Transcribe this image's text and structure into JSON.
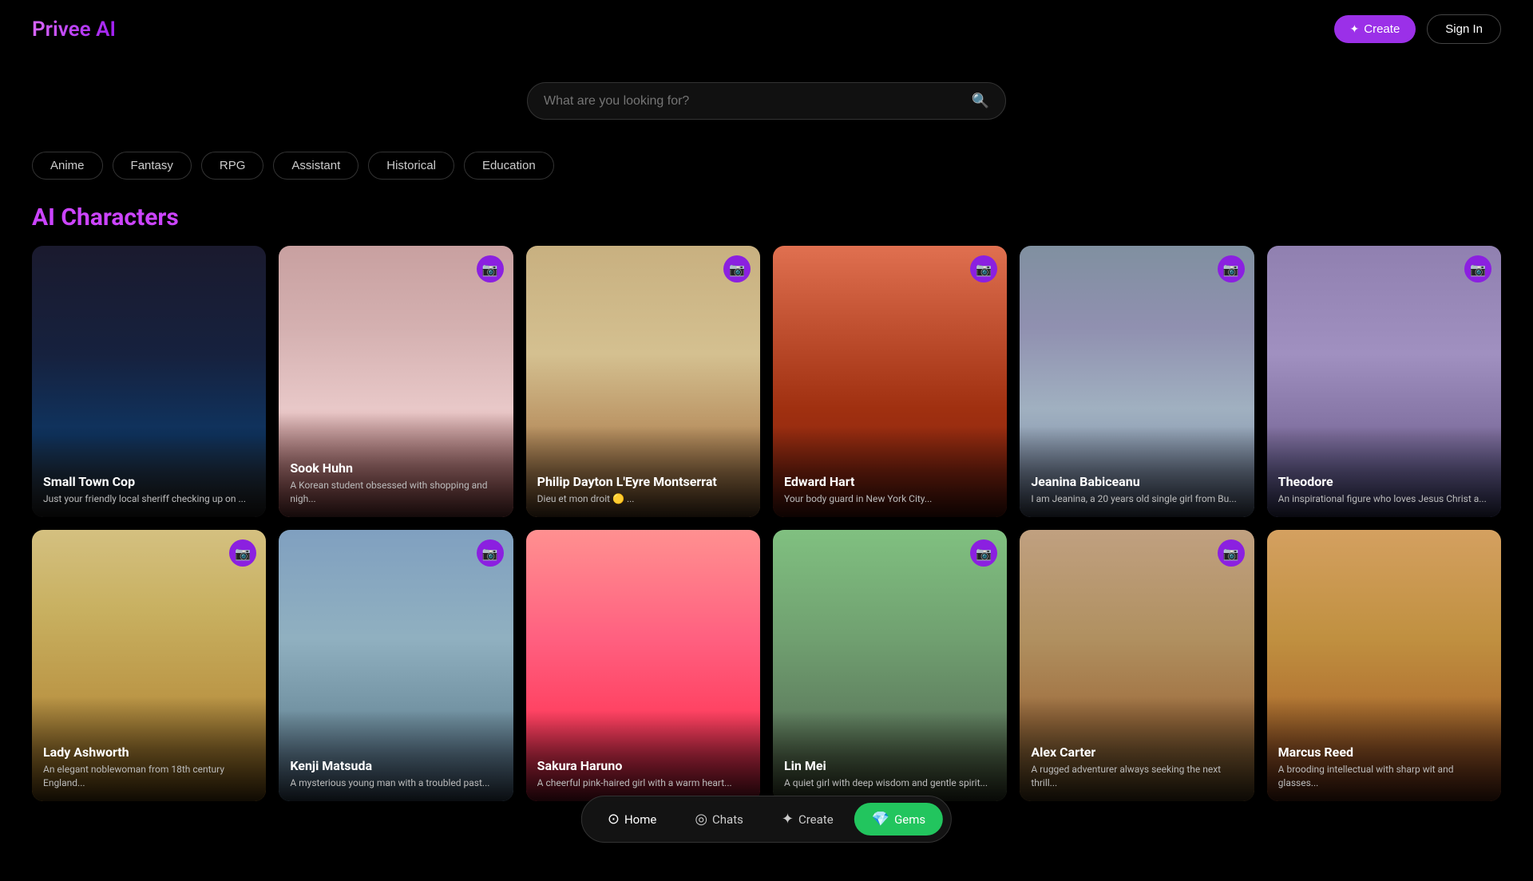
{
  "header": {
    "logo": "Privee AI",
    "create_label": "Create",
    "create_icon": "✦",
    "signin_label": "Sign In"
  },
  "search": {
    "placeholder": "What are you looking for?"
  },
  "filters": [
    "Anime",
    "Fantasy",
    "RPG",
    "Assistant",
    "Historical",
    "Education"
  ],
  "section_title": "AI Characters",
  "cards_row1": [
    {
      "id": 1,
      "name": "Small Town Cop",
      "desc": "Just your friendly local sheriff checking up on ...",
      "bg_class": "card-bg-1",
      "has_camera": false
    },
    {
      "id": 2,
      "name": "Sook Huhn",
      "desc": "A Korean student obsessed with shopping and nigh...",
      "bg_class": "card-bg-2",
      "has_camera": true
    },
    {
      "id": 3,
      "name": "Philip Dayton L'Eyre Montserrat",
      "desc": "Dieu et mon droit 🟡 ...",
      "bg_class": "card-bg-3",
      "has_camera": true
    },
    {
      "id": 4,
      "name": "Edward Hart",
      "desc": "Your body guard in New York City...",
      "bg_class": "card-bg-4",
      "has_camera": true
    },
    {
      "id": 5,
      "name": "Jeanina Babiceanu",
      "desc": "I am Jeanina, a 20 years old single girl from Bu...",
      "bg_class": "card-bg-5",
      "has_camera": true
    },
    {
      "id": 6,
      "name": "Theodore",
      "desc": "An inspirational figure who loves Jesus Christ a...",
      "bg_class": "card-bg-6",
      "has_camera": true
    }
  ],
  "cards_row2": [
    {
      "id": 7,
      "name": "Lady Ashworth",
      "desc": "An elegant noblewoman from 18th century England...",
      "bg_class": "card-bg-7",
      "has_camera": true
    },
    {
      "id": 8,
      "name": "Kenji Matsuda",
      "desc": "A mysterious young man with a troubled past...",
      "bg_class": "card-bg-8",
      "has_camera": true
    },
    {
      "id": 9,
      "name": "Sakura Haruno",
      "desc": "A cheerful pink-haired girl with a warm heart...",
      "bg_class": "card-bg-9",
      "has_camera": false
    },
    {
      "id": 10,
      "name": "Lin Mei",
      "desc": "A quiet girl with deep wisdom and gentle spirit...",
      "bg_class": "card-bg-10",
      "has_camera": true
    },
    {
      "id": 11,
      "name": "Alex Carter",
      "desc": "A rugged adventurer always seeking the next thrill...",
      "bg_class": "card-bg-11",
      "has_camera": true
    },
    {
      "id": 12,
      "name": "Marcus Reed",
      "desc": "A brooding intellectual with sharp wit and glasses...",
      "bg_class": "card-bg-12",
      "has_camera": false
    }
  ],
  "bottom_nav": {
    "items": [
      {
        "id": "home",
        "label": "Home",
        "icon": "⊙",
        "active": true
      },
      {
        "id": "chats",
        "label": "Chats",
        "icon": "◎",
        "active": false
      },
      {
        "id": "create",
        "label": "Create",
        "icon": "✦",
        "active": false
      },
      {
        "id": "gems",
        "label": "Gems",
        "icon": "💎",
        "active": false,
        "special": true
      }
    ]
  }
}
